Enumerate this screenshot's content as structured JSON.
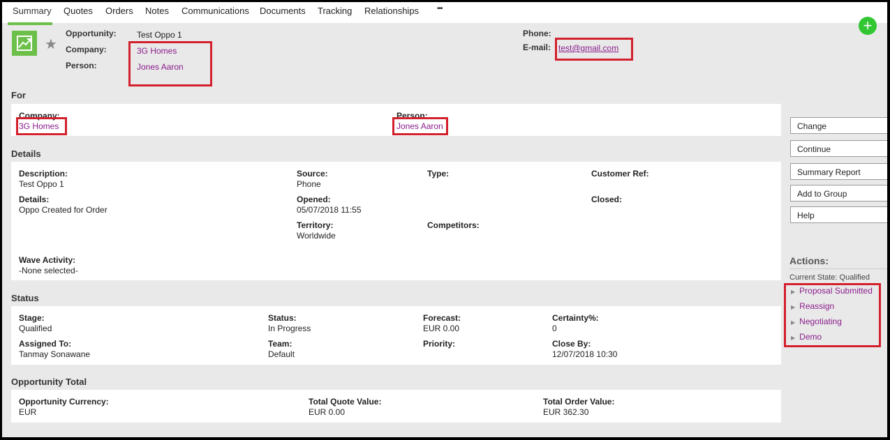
{
  "tabs": [
    {
      "label": "Summary"
    },
    {
      "label": "Quotes"
    },
    {
      "label": "Orders"
    },
    {
      "label": "Notes"
    },
    {
      "label": "Communications"
    },
    {
      "label": "Documents"
    },
    {
      "label": "Tracking"
    },
    {
      "label": "Relationships"
    },
    {
      "label": "•••"
    }
  ],
  "header": {
    "opportunity_label": "Opportunity:",
    "opportunity_value": "Test Oppo 1",
    "company_label": "Company:",
    "company_value": "3G Homes",
    "person_label": "Person:",
    "person_value": "Jones Aaron",
    "phone_label": "Phone:",
    "email_label": "E-mail:",
    "email_value": "test@gmail.com"
  },
  "for_section": {
    "title": "For",
    "company_label": "Company:",
    "company_value": "3G Homes",
    "person_label": "Person:",
    "person_value": "Jones Aaron"
  },
  "details": {
    "title": "Details",
    "description_label": "Description:",
    "description_value": "Test Oppo 1",
    "details_label": "Details:",
    "details_value": "Oppo Created for Order",
    "source_label": "Source:",
    "source_value": "Phone",
    "opened_label": "Opened:",
    "opened_value": "05/07/2018 11:55",
    "territory_label": "Territory:",
    "territory_value": "Worldwide",
    "type_label": "Type:",
    "competitors_label": "Competitors:",
    "customer_ref_label": "Customer Ref:",
    "closed_label": "Closed:",
    "wave_label": "Wave Activity:",
    "wave_value": "-None selected-"
  },
  "status": {
    "title": "Status",
    "stage_label": "Stage:",
    "stage_value": "Qualified",
    "assigned_label": "Assigned To:",
    "assigned_value": "Tanmay Sonawane",
    "status_label": "Status:",
    "status_value": "In Progress",
    "team_label": "Team:",
    "team_value": "Default",
    "forecast_label": "Forecast:",
    "forecast_value": "EUR 0.00",
    "priority_label": "Priority:",
    "certainty_label": "Certainty%:",
    "certainty_value": "0",
    "closeby_label": "Close By:",
    "closeby_value": "12/07/2018 10:30"
  },
  "total": {
    "title": "Opportunity Total",
    "currency_label": "Opportunity Currency:",
    "currency_value": "EUR",
    "quote_label": "Total Quote Value:",
    "quote_value": "EUR 0.00",
    "order_label": "Total Order Value:",
    "order_value": "EUR 362.30"
  },
  "buttons": {
    "change": "Change",
    "continue": "Continue",
    "summary_report": "Summary Report",
    "add_to_group": "Add to Group",
    "help": "Help"
  },
  "actions": {
    "title": "Actions:",
    "current_state": "Current State: Qualified",
    "items": [
      {
        "label": "Proposal Submitted"
      },
      {
        "label": "Reassign"
      },
      {
        "label": "Negotiating"
      },
      {
        "label": "Demo"
      }
    ]
  },
  "colors": {
    "accent_green": "#6cc04a",
    "link_purple": "#8a1c8a",
    "highlight_red": "#d3202c"
  }
}
